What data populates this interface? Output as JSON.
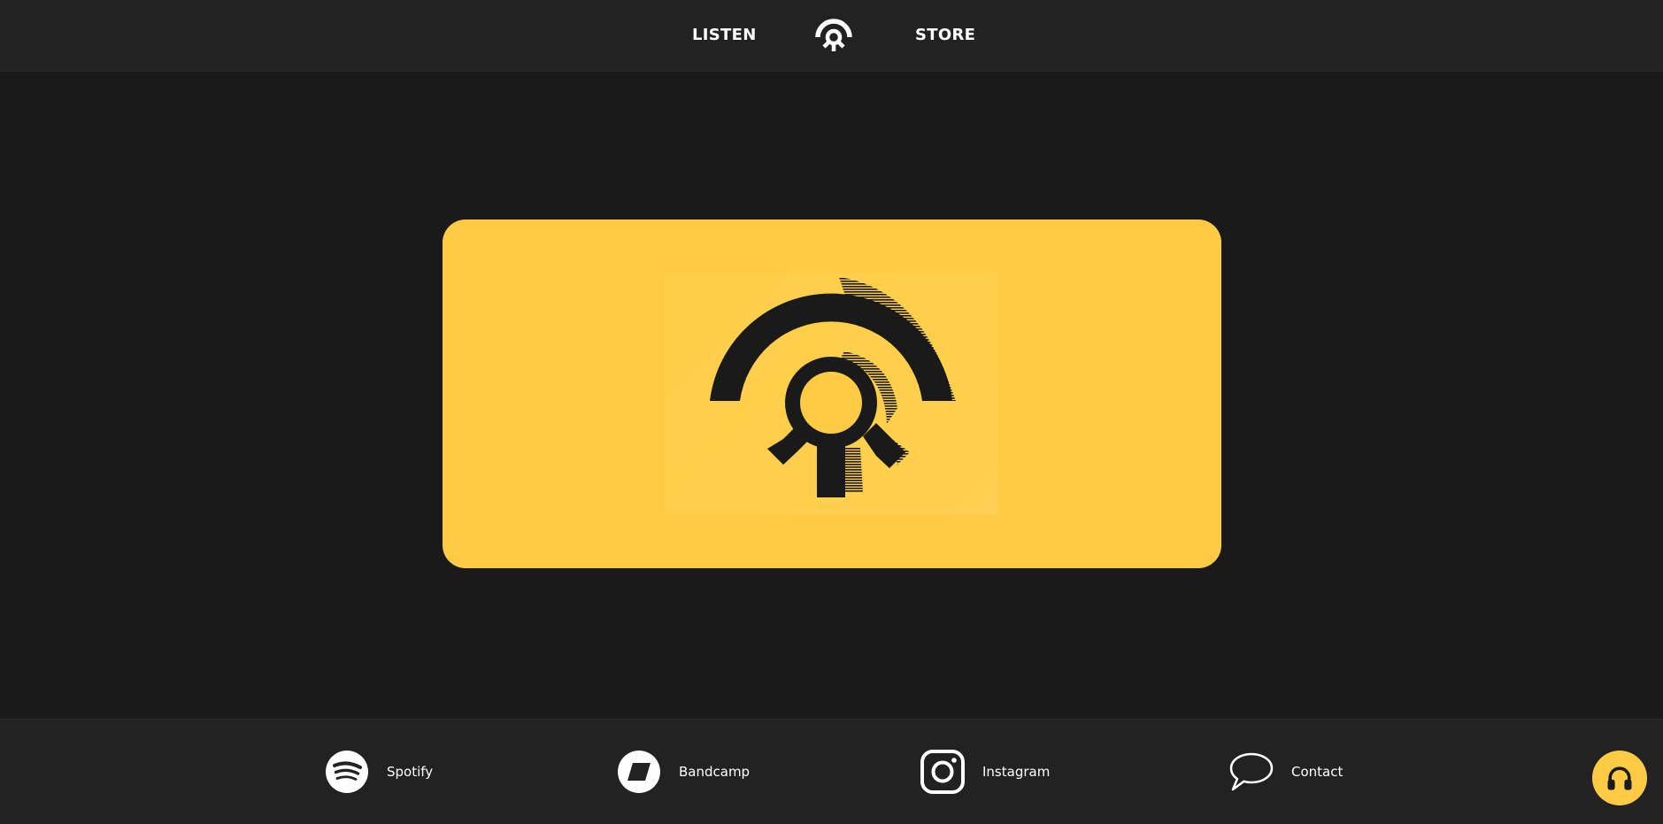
{
  "nav": {
    "listen_label": "LISTEN",
    "store_label": "STORE",
    "logo_icon": "brand-logo-icon"
  },
  "hero": {
    "background_color": "#ffcb45",
    "logo_icon": "brand-logo-glitch-icon"
  },
  "footer": {
    "links": [
      {
        "label": "Spotify",
        "icon": "spotify-icon"
      },
      {
        "label": "Bandcamp",
        "icon": "bandcamp-icon"
      },
      {
        "label": "Instagram",
        "icon": "instagram-icon"
      },
      {
        "label": "Contact",
        "icon": "speech-bubble-icon"
      }
    ]
  },
  "player": {
    "icon": "headphones-icon",
    "color": "#ffcb45"
  },
  "colors": {
    "page_background": "#1a1a1a",
    "bar_background": "#222222",
    "accent": "#ffcb45",
    "text": "#ffffff"
  }
}
